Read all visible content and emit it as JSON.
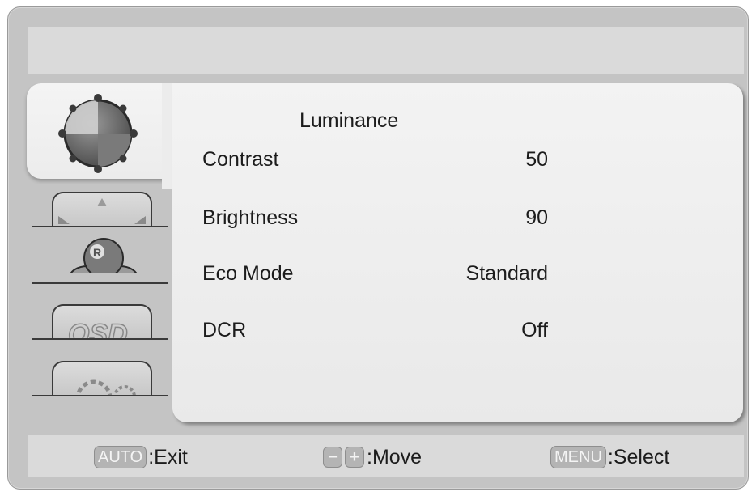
{
  "menu": {
    "title": "Luminance",
    "items": [
      {
        "label": "Contrast",
        "value": "50"
      },
      {
        "label": "Brightness",
        "value": "90"
      },
      {
        "label": "Eco Mode",
        "value": "Standard"
      },
      {
        "label": "DCR",
        "value": "Off"
      }
    ]
  },
  "sidebar": {
    "tabs": [
      {
        "icon": "luminance-dial-icon",
        "active": true
      },
      {
        "icon": "image-setup-icon",
        "active": false
      },
      {
        "icon": "color-temperature-icon",
        "active": false
      },
      {
        "icon": "osd-settings-icon",
        "active": false,
        "text": "OSD"
      },
      {
        "icon": "extra-settings-gears-icon",
        "active": false
      }
    ]
  },
  "footer": {
    "auto_key": "AUTO",
    "exit_label": ":Exit",
    "minus_key": "−",
    "plus_key": "+",
    "move_label": ":Move",
    "menu_key": "MENU",
    "select_label": ":Select"
  }
}
